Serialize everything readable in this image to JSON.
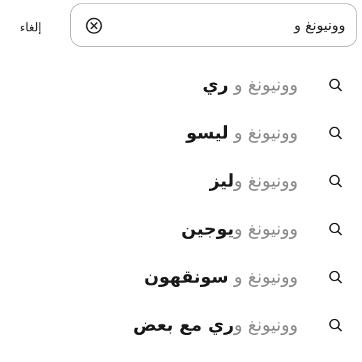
{
  "header": {
    "cancel_label": "إلغاء"
  },
  "search": {
    "value": "وونيونغ و",
    "clear_icon": "clear-circle-x-icon"
  },
  "suggestions": [
    {
      "prefix": "وونيونغ و ",
      "rest": "ري",
      "icon": "search-icon"
    },
    {
      "prefix": "وونيونغ و ",
      "rest": "ليسو",
      "icon": "search-icon"
    },
    {
      "prefix": "وونيونغ و",
      "rest": "ليز",
      "icon": "search-icon"
    },
    {
      "prefix": "وونيونغ و",
      "rest": "يوجين",
      "icon": "search-icon"
    },
    {
      "prefix": "وونيونغ و ",
      "rest": "سونقهون",
      "icon": "search-icon"
    },
    {
      "prefix": "وونيونغ و",
      "rest": "ري مع بعض",
      "icon": "search-icon"
    }
  ],
  "colors": {
    "text": "#1a1a1a",
    "muted": "#8a8a8a",
    "border": "#a8a8a8",
    "background": "#ffffff"
  }
}
